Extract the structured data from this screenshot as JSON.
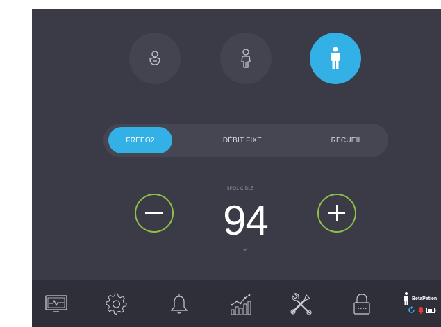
{
  "colors": {
    "screen_bg": "#3a3b46",
    "accent": "#33b0e5",
    "button_ring": "#8fbf45",
    "bar_bg": "#2e2f39"
  },
  "profiles": [
    {
      "name": "infant",
      "icon": "baby-icon",
      "active": false
    },
    {
      "name": "child",
      "icon": "child-icon",
      "active": false
    },
    {
      "name": "adult",
      "icon": "adult-icon",
      "active": true
    }
  ],
  "modes": [
    {
      "label": "FREEO2",
      "active": true
    },
    {
      "label": "DÉBIT FIXE",
      "active": false
    },
    {
      "label": "RECUEIL",
      "active": false
    }
  ],
  "target": {
    "label": "SPO2 CIBLE",
    "value": "94",
    "unit": "%"
  },
  "nav": [
    {
      "icon": "monitor-icon"
    },
    {
      "icon": "settings-gear-icon"
    },
    {
      "icon": "bell-icon"
    },
    {
      "icon": "trend-chart-icon"
    },
    {
      "icon": "tools-icon"
    },
    {
      "icon": "lock-icon"
    }
  ],
  "patient": {
    "name": "BetaPatien"
  }
}
